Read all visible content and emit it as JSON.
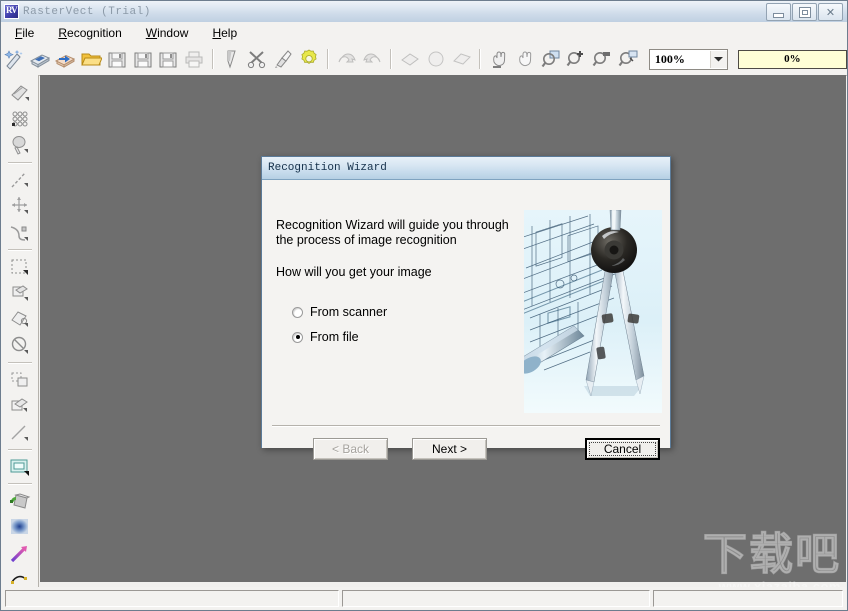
{
  "window": {
    "title": "RasterVect (Trial)",
    "icon": "app-icon",
    "controls": {
      "minimize": "Minimize",
      "maximize": "Maximize",
      "close": "Close"
    }
  },
  "menubar": {
    "items": [
      {
        "label": "File",
        "accel": "F"
      },
      {
        "label": "Recognition",
        "accel": "R"
      },
      {
        "label": "Window",
        "accel": "W"
      },
      {
        "label": "Help",
        "accel": "H"
      }
    ]
  },
  "toolbar": {
    "buttons": [
      {
        "name": "recognition-wizard-icon",
        "title": "Recognition Wizard",
        "enabled": true
      },
      {
        "name": "scan-image-icon",
        "title": "Scan Image",
        "enabled": true
      },
      {
        "name": "import-image-icon",
        "title": "Import Image",
        "enabled": true
      },
      {
        "name": "open-folder-icon",
        "title": "Open",
        "enabled": true
      },
      {
        "name": "save-icon",
        "title": "Save",
        "enabled": true
      },
      {
        "name": "save-as-icon",
        "title": "Save As",
        "enabled": true
      },
      {
        "name": "save-all-icon",
        "title": "Save All",
        "enabled": true
      },
      {
        "name": "print-icon",
        "title": "Print",
        "enabled": false
      },
      {
        "name": "select-tool-icon",
        "title": "Select",
        "enabled": true
      },
      {
        "name": "cut-icon",
        "title": "Cut",
        "enabled": true
      },
      {
        "name": "eraser-icon",
        "title": "Erase",
        "enabled": true
      },
      {
        "name": "options-gear-icon",
        "title": "Options",
        "enabled": true
      },
      {
        "name": "undo-icon",
        "title": "Undo",
        "enabled": false
      },
      {
        "name": "redo-icon",
        "title": "Redo",
        "enabled": false
      },
      {
        "name": "layer-icon",
        "title": "Layer",
        "enabled": false
      },
      {
        "name": "layer-group-icon",
        "title": "Layer Group",
        "enabled": false
      },
      {
        "name": "layer-copy-icon",
        "title": "Layer Copy",
        "enabled": false
      },
      {
        "name": "pan-hand-icon",
        "title": "Pan",
        "enabled": true
      },
      {
        "name": "grab-hand-icon",
        "title": "Grab",
        "enabled": true
      },
      {
        "name": "zoom-window-icon",
        "title": "Zoom Window",
        "enabled": true
      },
      {
        "name": "zoom-in-icon",
        "title": "Zoom In",
        "enabled": true
      },
      {
        "name": "zoom-out-icon",
        "title": "Zoom Out",
        "enabled": true
      },
      {
        "name": "zoom-fit-icon",
        "title": "Zoom Fit",
        "enabled": true
      }
    ],
    "zoom_value": "100%",
    "progress_label": "0%",
    "progress_percent": 0
  },
  "lefttoolbar": {
    "buttons": [
      {
        "name": "vector-tool-icon",
        "title": "Vector Tool"
      },
      {
        "name": "halftone-icon",
        "title": "Halftone"
      },
      {
        "name": "fill-tool-icon",
        "title": "Fill Tool"
      },
      {
        "name": "line-tool-icon",
        "title": "Line"
      },
      {
        "name": "move-nodes-icon",
        "title": "Move Nodes"
      },
      {
        "name": "curve-tool-icon",
        "title": "Curve"
      },
      {
        "name": "marquee-select-icon",
        "title": "Marquee Select"
      },
      {
        "name": "shape-tool-icon",
        "title": "Shape"
      },
      {
        "name": "polygon-tool-icon",
        "title": "Polygon"
      },
      {
        "name": "no-tool-icon",
        "title": "Delete Tool"
      },
      {
        "name": "copy-region-icon",
        "title": "Copy Region"
      },
      {
        "name": "duplicate-icon",
        "title": "Duplicate"
      },
      {
        "name": "straight-line-icon",
        "title": "Straight Line"
      },
      {
        "name": "rectangle-select-icon",
        "title": "Rectangle Select"
      },
      {
        "name": "paint-bucket-icon",
        "title": "Paint Bucket"
      },
      {
        "name": "blur-tool-icon",
        "title": "Blur"
      },
      {
        "name": "gradient-arrow-icon",
        "title": "Gradient"
      },
      {
        "name": "arc-tool-icon",
        "title": "Arc"
      }
    ]
  },
  "statusbar": {
    "panel1": "",
    "panel2": "",
    "panel3": ""
  },
  "dialog": {
    "title": "Recognition Wizard",
    "intro_line1": "Recognition Wizard will guide you through",
    "intro_line2": "the process of image recognition",
    "question": "How will you get your image",
    "options": [
      {
        "label": "From scanner",
        "selected": false
      },
      {
        "label": "From file",
        "selected": true
      }
    ],
    "buttons": {
      "back": "< Back",
      "next": "Next >",
      "cancel": "Cancel"
    },
    "image_alt": "blueprint-compass-photo"
  },
  "watermark": {
    "text": "下载吧",
    "url": "www.xiazaiba.com"
  },
  "colors": {
    "canvas": "#6e6e6e",
    "chrome": "#f3f2f0",
    "titlebar_start": "#eef3f8",
    "titlebar_end": "#bfd0e2",
    "dialog_border": "#5b7b99",
    "progress_bg": "#ffffd6"
  }
}
